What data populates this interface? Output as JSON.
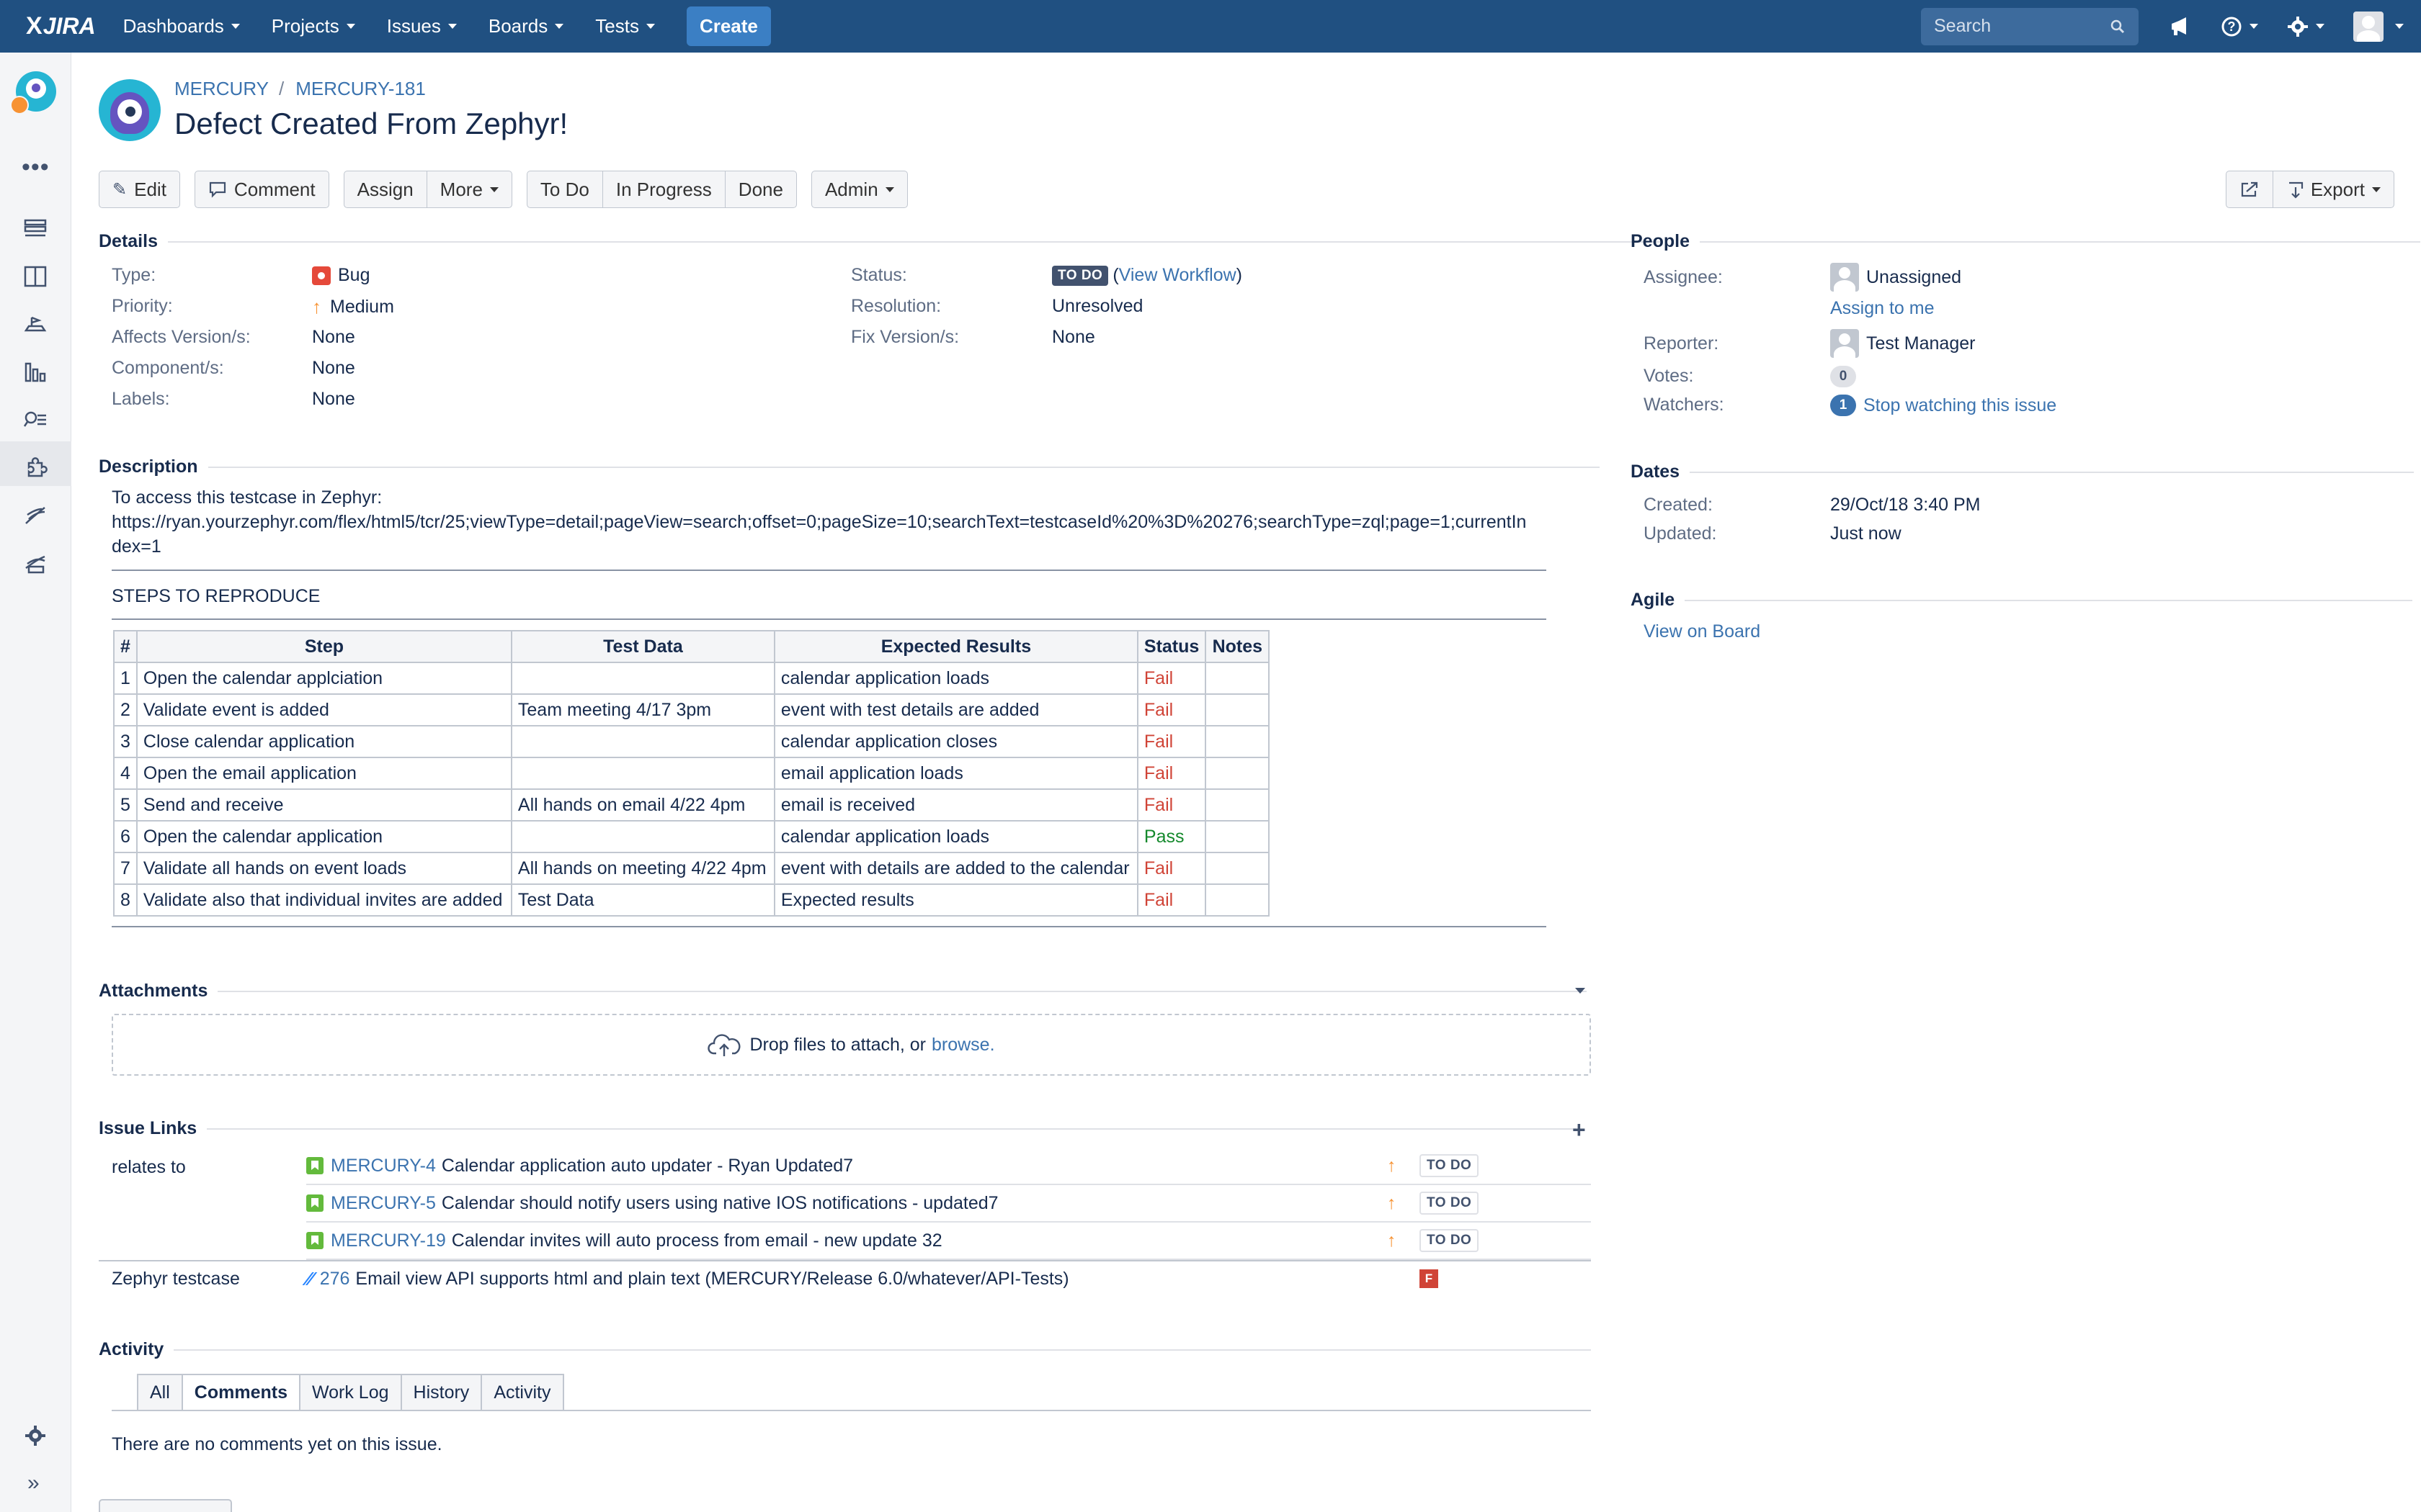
{
  "topnav": {
    "logo_x": "X",
    "logo_text": "JIRA",
    "menus": [
      "Dashboards",
      "Projects",
      "Issues",
      "Boards",
      "Tests"
    ],
    "create_label": "Create",
    "search_placeholder": "Search"
  },
  "breadcrumb": {
    "project": "MERCURY",
    "sep": "/",
    "issue_key": "MERCURY-181"
  },
  "issue": {
    "title": "Defect Created From Zephyr!"
  },
  "toolbar": {
    "edit": "Edit",
    "comment": "Comment",
    "assign": "Assign",
    "more": "More",
    "todo": "To Do",
    "in_progress": "In Progress",
    "done": "Done",
    "admin": "Admin",
    "export": "Export"
  },
  "details": {
    "heading": "Details",
    "type_label": "Type:",
    "type_value": "Bug",
    "priority_label": "Priority:",
    "priority_value": "Medium",
    "affects_label": "Affects Version/s:",
    "affects_value": "None",
    "component_label": "Component/s:",
    "component_value": "None",
    "labels_label": "Labels:",
    "labels_value": "None",
    "status_label": "Status:",
    "status_value": "TO DO",
    "view_workflow": "View Workflow",
    "resolution_label": "Resolution:",
    "resolution_value": "Unresolved",
    "fix_label": "Fix Version/s:",
    "fix_value": "None"
  },
  "description": {
    "heading": "Description",
    "intro": "To access this testcase in Zephyr:",
    "url_line1": "https://ryan.yourzephyr.com/flex/html5/tcr/25;viewType=detail;pageView=search;offset=0;pageSize=10;searchText=testcaseId%20%3D%20276;searchType=zql;page=1;currentIn",
    "url_line2": "dex=1",
    "steps_heading": "STEPS TO REPRODUCE",
    "columns": [
      "#",
      "Step",
      "Test Data",
      "Expected Results",
      "Status",
      "Notes"
    ],
    "rows": [
      {
        "n": "1",
        "step": "Open the calendar applciation",
        "data": "",
        "expected": "calendar application loads",
        "status": "Fail",
        "notes": ""
      },
      {
        "n": "2",
        "step": "Validate event is added",
        "data": "Team meeting 4/17 3pm",
        "expected": "event with test details are added",
        "status": "Fail",
        "notes": ""
      },
      {
        "n": "3",
        "step": "Close calendar application",
        "data": "",
        "expected": "calendar application closes",
        "status": "Fail",
        "notes": ""
      },
      {
        "n": "4",
        "step": "Open the email application",
        "data": "",
        "expected": "email application loads",
        "status": "Fail",
        "notes": ""
      },
      {
        "n": "5",
        "step": "Send and receive",
        "data": "All hands on email 4/22 4pm",
        "expected": "email is received",
        "status": "Fail",
        "notes": ""
      },
      {
        "n": "6",
        "step": "Open the calendar application",
        "data": "",
        "expected": "calendar application loads",
        "status": "Pass",
        "notes": ""
      },
      {
        "n": "7",
        "step": "Validate all hands on event loads",
        "data": "All hands on meeting 4/22 4pm",
        "expected": "event with details are added to the calendar",
        "status": "Fail",
        "notes": ""
      },
      {
        "n": "8",
        "step": "Validate also that individual invites are added",
        "data": "Test Data",
        "expected": "Expected results",
        "status": "Fail",
        "notes": ""
      }
    ]
  },
  "attachments": {
    "heading": "Attachments",
    "drop_text": "Drop files to attach, or",
    "browse": "browse."
  },
  "issue_links": {
    "heading": "Issue Links",
    "relates_label": "relates to",
    "relates": [
      {
        "key": "MERCURY-4",
        "summary": "Calendar application auto updater - Ryan Updated7",
        "status": "TO DO"
      },
      {
        "key": "MERCURY-5",
        "summary": "Calendar should notify users using native IOS notifications - updated7",
        "status": "TO DO"
      },
      {
        "key": "MERCURY-19",
        "summary": "Calendar invites will auto process from email - new update 32",
        "status": "TO DO"
      }
    ],
    "zephyr_label": "Zephyr testcase",
    "zephyr": {
      "id": "276",
      "summary": "Email view API supports html and plain text (MERCURY/Release 6.0/whatever/API-Tests)",
      "status": "F"
    }
  },
  "activity": {
    "heading": "Activity",
    "tabs": [
      "All",
      "Comments",
      "Work Log",
      "History",
      "Activity"
    ],
    "empty_text": "There are no comments yet on this issue."
  },
  "people": {
    "heading": "People",
    "assignee_label": "Assignee:",
    "assignee_value": "Unassigned",
    "assign_to_me": "Assign to me",
    "reporter_label": "Reporter:",
    "reporter_value": "Test Manager",
    "votes_label": "Votes:",
    "votes_value": "0",
    "watchers_label": "Watchers:",
    "watchers_value": "1",
    "stop_watching": "Stop watching this issue"
  },
  "dates": {
    "heading": "Dates",
    "created_label": "Created:",
    "created_value": "29/Oct/18 3:40 PM",
    "updated_label": "Updated:",
    "updated_value": "Just now"
  },
  "agile": {
    "heading": "Agile",
    "view_on_board": "View on Board"
  },
  "colors": {
    "nav": "#205081",
    "link": "#205081",
    "fail": "#d04437",
    "pass": "#14892c",
    "priority": "#f79232"
  },
  "icons": [
    "search-icon",
    "notifications-icon",
    "help-icon",
    "settings-icon",
    "edit-icon",
    "comment-icon",
    "share-icon",
    "export-icon",
    "upload-cloud-icon",
    "add-link-icon",
    "bug-icon",
    "priority-medium-icon",
    "story-icon",
    "zephyr-icon"
  ]
}
